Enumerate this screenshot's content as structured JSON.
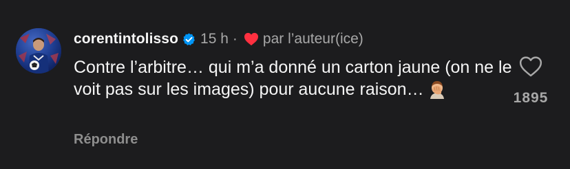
{
  "comment": {
    "username": "corentintolisso",
    "verified": true,
    "timestamp": "15 h",
    "separator": "·",
    "liked_by_author_label": "par l’auteur(ice)",
    "text": "Contre l’arbitre… qui m’a donné un carton jaune (on ne le voit pas sur les images) pour aucune raison…",
    "emoji_icon": "facepalm-emoji",
    "reply_label": "Répondre",
    "like_count": "1895"
  },
  "colors": {
    "background": "#1c1c1e",
    "primary_text": "#f5f5f5",
    "secondary_text": "#a8a8a8",
    "verified_blue": "#0095f6",
    "heart_red": "#ff3040"
  },
  "icons": {
    "verified": "verified-badge-icon",
    "author_like": "red-heart-icon",
    "like_button": "heart-outline-icon"
  }
}
